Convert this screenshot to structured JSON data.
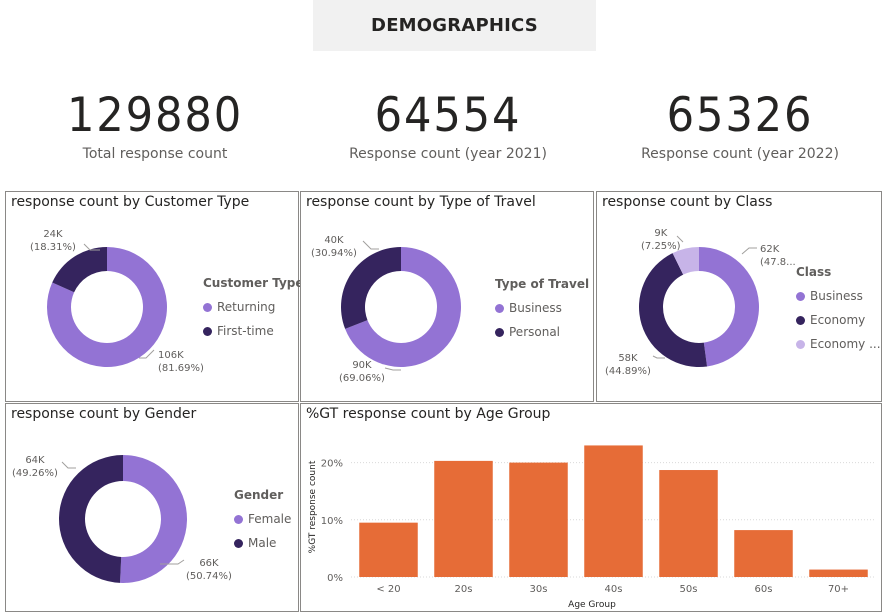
{
  "header": {
    "title": "DEMOGRAPHICS"
  },
  "kpis": [
    {
      "value": "129880",
      "label": "Total response count"
    },
    {
      "value": "64554",
      "label": "Response count (year 2021)"
    },
    {
      "value": "65326",
      "label": "Response count (year 2022)"
    }
  ],
  "colors": {
    "purple_light": "#9373d4",
    "purple_dark": "#35245e",
    "purple_pale": "#c7b4e8",
    "orange": "#e66c37",
    "grid": "#d9d9d9"
  },
  "donuts": {
    "customer_type": {
      "title": "response count by Customer Type",
      "legend_title": "Customer Type",
      "legend": [
        "Returning",
        "First-time"
      ],
      "labels": [
        {
          "value": "106K",
          "pct": "(81.69%)"
        },
        {
          "value": "24K",
          "pct": "(18.31%)"
        }
      ]
    },
    "type_of_travel": {
      "title": "response count by Type of Travel",
      "legend_title": "Type of Travel",
      "legend": [
        "Business",
        "Personal"
      ],
      "labels": [
        {
          "value": "90K",
          "pct": "(69.06%)"
        },
        {
          "value": "40K",
          "pct": "(30.94%)"
        }
      ]
    },
    "class": {
      "title": "response count by Class",
      "legend_title": "Class",
      "legend": [
        "Business",
        "Economy",
        "Economy ..."
      ],
      "labels": [
        {
          "value": "62K",
          "pct": "(47.8..."
        },
        {
          "value": "58K",
          "pct": "(44.89%)"
        },
        {
          "value": "9K",
          "pct": "(7.25%)"
        }
      ]
    },
    "gender": {
      "title": "response count by Gender",
      "legend_title": "Gender",
      "legend": [
        "Female",
        "Male"
      ],
      "labels": [
        {
          "value": "66K",
          "pct": "(50.74%)"
        },
        {
          "value": "64K",
          "pct": "(49.26%)"
        }
      ]
    }
  },
  "chart_data": [
    {
      "type": "pie",
      "title": "response count by Customer Type",
      "categories": [
        "Returning",
        "First-time"
      ],
      "values": [
        81.69,
        18.31
      ],
      "value_labels": [
        "106K",
        "24K"
      ],
      "legend": "right"
    },
    {
      "type": "pie",
      "title": "response count by Type of Travel",
      "categories": [
        "Business",
        "Personal"
      ],
      "values": [
        69.06,
        30.94
      ],
      "value_labels": [
        "90K",
        "40K"
      ],
      "legend": "right"
    },
    {
      "type": "pie",
      "title": "response count by Class",
      "categories": [
        "Business",
        "Economy",
        "Economy ..."
      ],
      "values": [
        47.86,
        44.89,
        7.25
      ],
      "value_labels": [
        "62K",
        "58K",
        "9K"
      ],
      "legend": "right"
    },
    {
      "type": "pie",
      "title": "response count by Gender",
      "categories": [
        "Female",
        "Male"
      ],
      "values": [
        50.74,
        49.26
      ],
      "value_labels": [
        "66K",
        "64K"
      ],
      "legend": "right"
    },
    {
      "type": "bar",
      "title": "%GT response count by Age Group",
      "categories": [
        "< 20",
        "20s",
        "30s",
        "40s",
        "50s",
        "60s",
        "70+"
      ],
      "values": [
        9.5,
        20.3,
        20.0,
        23.0,
        18.7,
        8.2,
        1.3
      ],
      "xlabel": "Age Group",
      "ylabel": "%GT response count",
      "ylim": [
        0,
        25
      ],
      "yticks": [
        "0%",
        "10%",
        "20%"
      ],
      "ytick_values": [
        0,
        10,
        20
      ],
      "grid": true
    }
  ]
}
